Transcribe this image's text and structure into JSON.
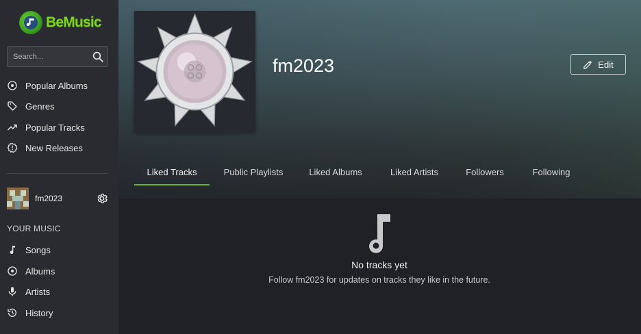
{
  "brand": {
    "name": "BeMusic",
    "color": "#7ed321"
  },
  "search": {
    "placeholder": "Search..."
  },
  "nav": {
    "items": [
      {
        "label": "Popular Albums",
        "icon": "album-icon"
      },
      {
        "label": "Genres",
        "icon": "tag-icon"
      },
      {
        "label": "Popular Tracks",
        "icon": "trending-up-icon"
      },
      {
        "label": "New Releases",
        "icon": "new-releases-icon"
      }
    ]
  },
  "user": {
    "name": "fm2023"
  },
  "your_music": {
    "title": "YOUR MUSIC",
    "items": [
      {
        "label": "Songs",
        "icon": "music-note-icon"
      },
      {
        "label": "Albums",
        "icon": "album-icon"
      },
      {
        "label": "Artists",
        "icon": "microphone-icon"
      },
      {
        "label": "History",
        "icon": "history-icon"
      }
    ]
  },
  "profile": {
    "name": "fm2023",
    "edit_label": "Edit"
  },
  "tabs": [
    {
      "label": "Liked Tracks",
      "active": true
    },
    {
      "label": "Public Playlists",
      "active": false
    },
    {
      "label": "Liked Albums",
      "active": false
    },
    {
      "label": "Liked Artists",
      "active": false
    },
    {
      "label": "Followers",
      "active": false
    },
    {
      "label": "Following",
      "active": false
    }
  ],
  "empty_state": {
    "title": "No tracks yet",
    "subtitle": "Follow fm2023 for updates on tracks they like in the future.",
    "icon": "music-note-icon"
  },
  "colors": {
    "accent": "#6bb43c",
    "sidebar_bg": "#2a2b30",
    "page_bg": "#202126"
  }
}
